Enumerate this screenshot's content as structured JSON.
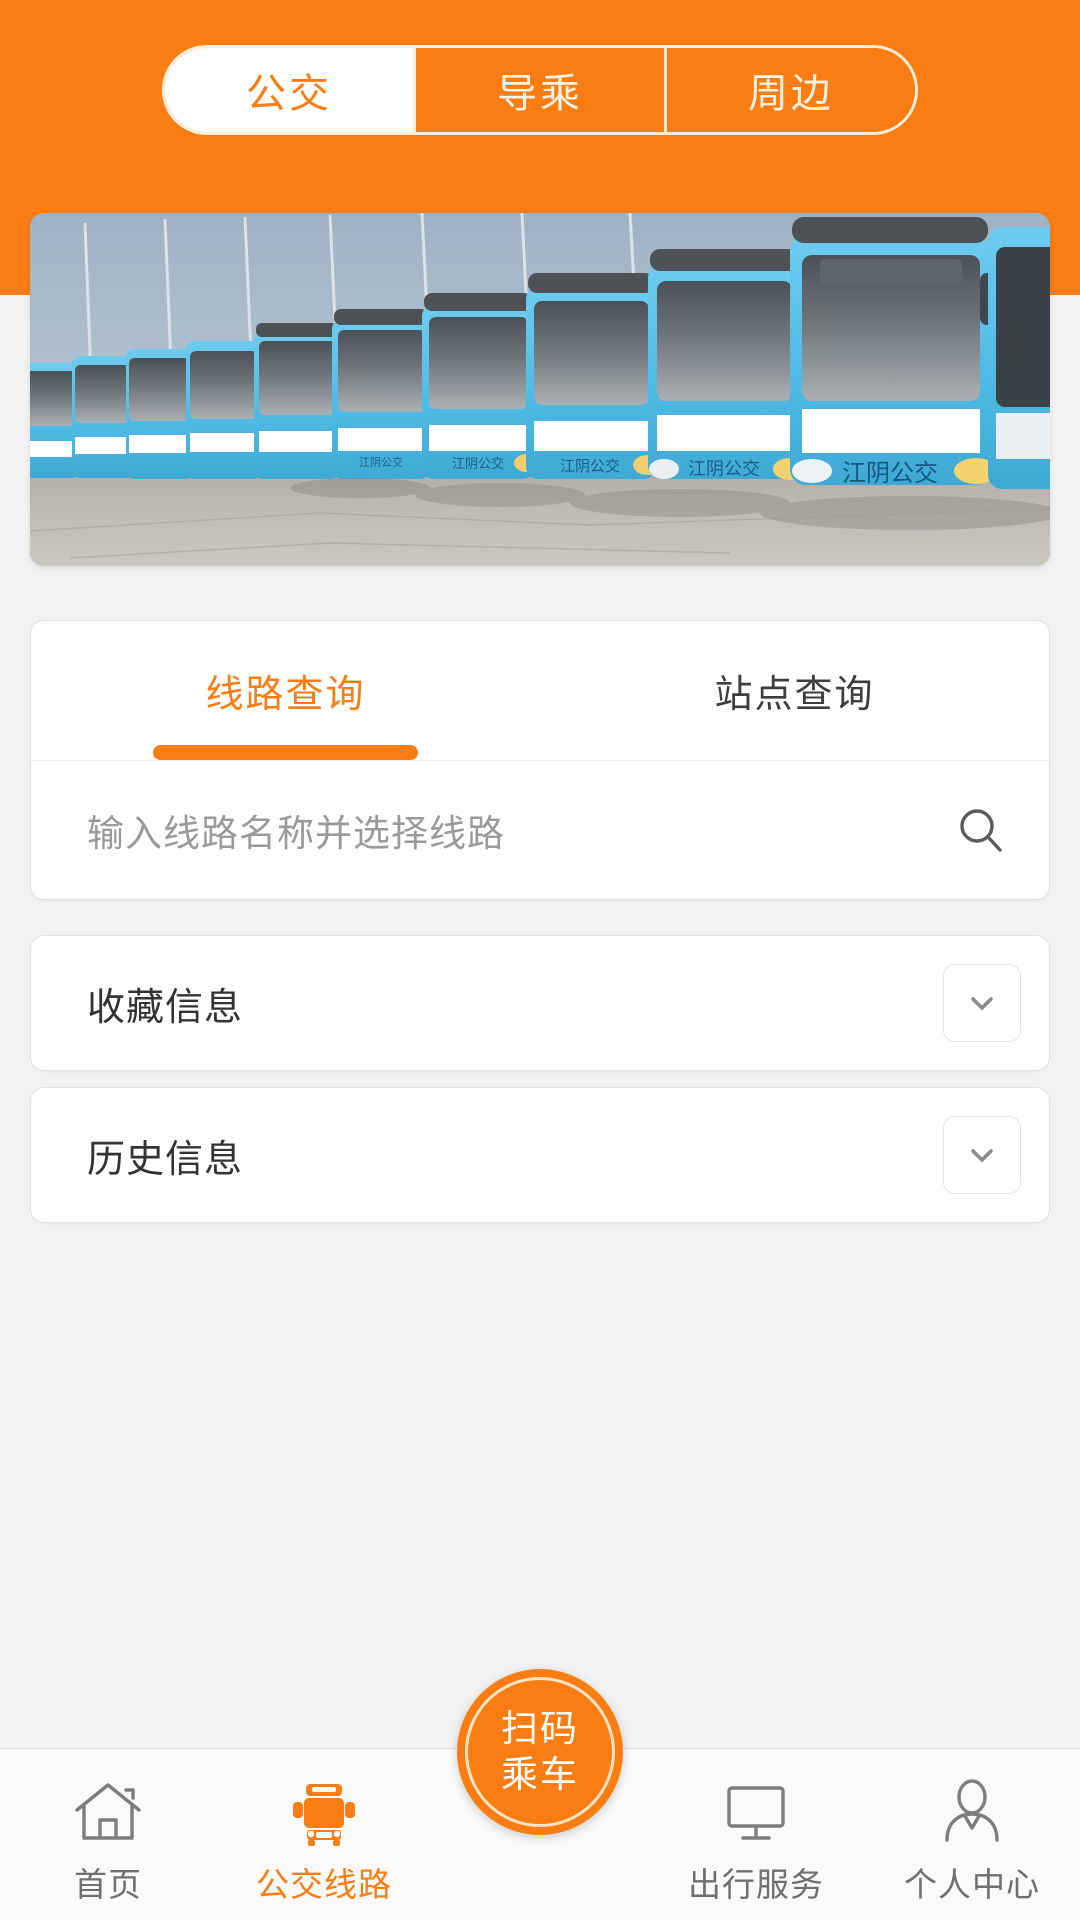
{
  "theme": {
    "accent": "#f97d12",
    "header_bg": "#f97d12",
    "page_bg": "#f2f2f2",
    "card_bg": "#ffffff",
    "muted_text": "#9a9a9a",
    "body_text": "#333333",
    "bus_blue": "#56bfe8"
  },
  "header": {
    "segments": [
      {
        "label": "公交",
        "active": true
      },
      {
        "label": "导乘",
        "active": false
      },
      {
        "label": "周边",
        "active": false
      }
    ]
  },
  "banner": {
    "alt": "江阴公交 bus fleet photo",
    "bus_text": "江阴公交",
    "icon": "banner-image"
  },
  "search_card": {
    "tabs": [
      {
        "label": "线路查询",
        "active": true
      },
      {
        "label": "站点查询",
        "active": false
      }
    ],
    "search": {
      "value": "",
      "placeholder": "输入线路名称并选择线路",
      "icon": "search-icon"
    }
  },
  "collapse_rows": [
    {
      "label": "收藏信息",
      "icon": "chevron-down-icon",
      "expanded": false
    },
    {
      "label": "历史信息",
      "icon": "chevron-down-icon",
      "expanded": false
    }
  ],
  "tabbar": {
    "items": [
      {
        "label": "首页",
        "icon": "home-icon",
        "active": false
      },
      {
        "label": "公交线路",
        "icon": "bus-icon",
        "active": true
      },
      {
        "label": "出行服务",
        "icon": "monitor-icon",
        "active": false
      },
      {
        "label": "个人中心",
        "icon": "person-icon",
        "active": false
      }
    ],
    "fab": {
      "line1": "扫码",
      "line2": "乘车",
      "icon": "scan-qr-ride-button"
    }
  }
}
